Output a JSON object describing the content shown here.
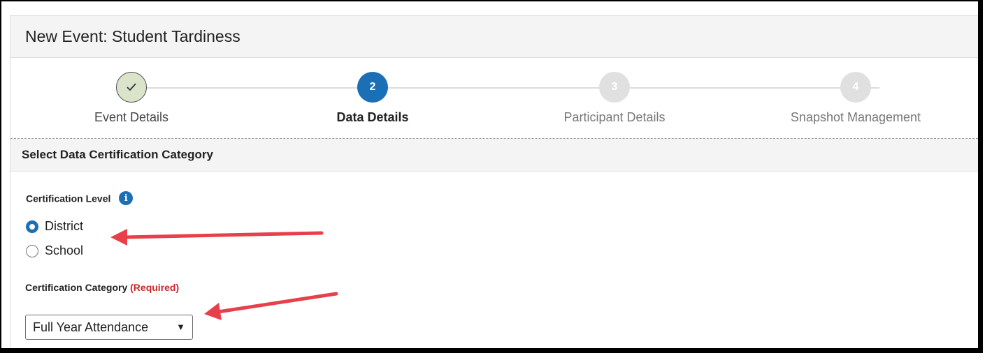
{
  "header": {
    "title": "New Event: Student Tardiness"
  },
  "stepper": {
    "steps": [
      {
        "number": "",
        "label": "Event Details",
        "state": "done"
      },
      {
        "number": "2",
        "label": "Data Details",
        "state": "active"
      },
      {
        "number": "3",
        "label": "Participant Details",
        "state": "todo"
      },
      {
        "number": "4",
        "label": "Snapshot Management",
        "state": "todo"
      }
    ]
  },
  "section": {
    "title": "Select Data Certification Category",
    "certification_level": {
      "label": "Certification Level",
      "info_icon": "info-icon",
      "options": [
        {
          "label": "District",
          "selected": true
        },
        {
          "label": "School",
          "selected": false
        }
      ]
    },
    "certification_category": {
      "label": "Certification Category",
      "required_text": "(Required)",
      "value": "Full Year Attendance"
    }
  },
  "colors": {
    "accent": "#1a6fb5",
    "done_step": "#d9e4cb",
    "required": "#c62828",
    "annotation_arrow": "#e8404a"
  }
}
